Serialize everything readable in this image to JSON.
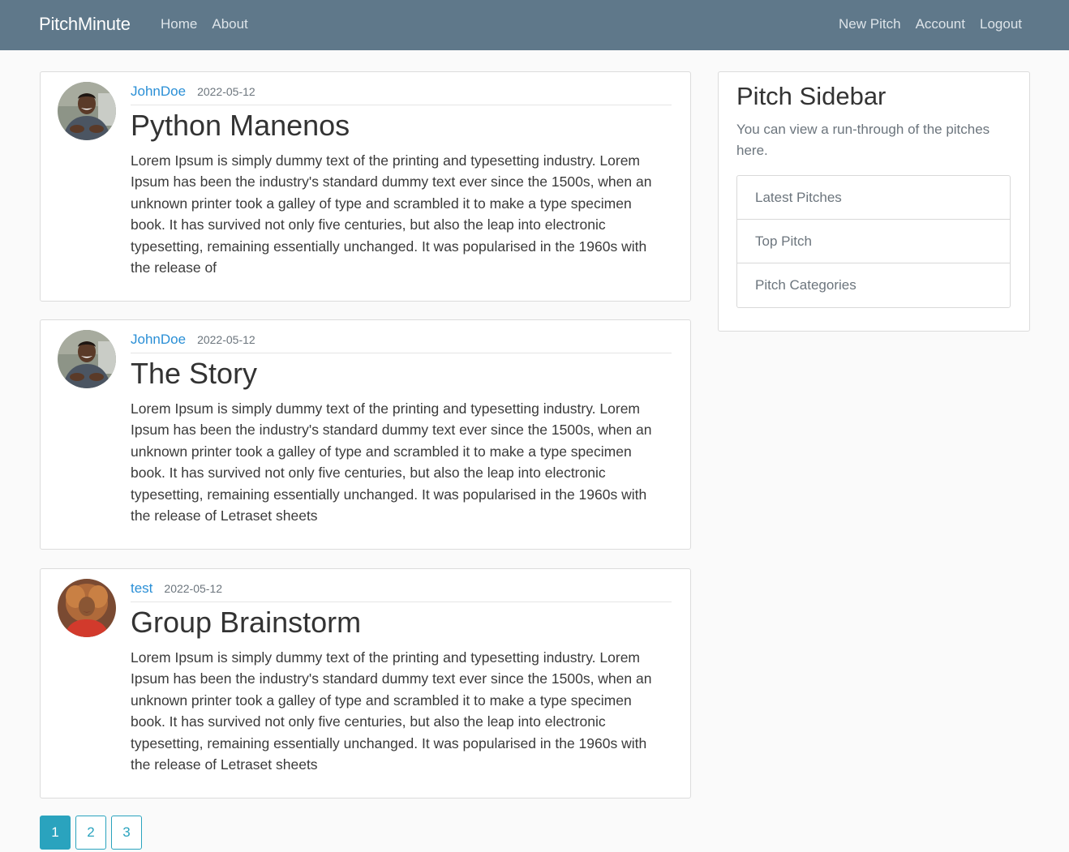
{
  "nav": {
    "brand": "PitchMinute",
    "left_links": [
      "Home",
      "About"
    ],
    "right_links": [
      "New Pitch",
      "Account",
      "Logout"
    ]
  },
  "posts": [
    {
      "author": "JohnDoe",
      "date": "2022-05-12",
      "title": "Python Manenos",
      "body": "Lorem Ipsum is simply dummy text of the printing and typesetting industry. Lorem Ipsum has been the industry's standard dummy text ever since the 1500s, when an unknown printer took a galley of type and scrambled it to make a type specimen book. It has survived not only five centuries, but also the leap into electronic typesetting, remaining essentially unchanged. It was popularised in the 1960s with the release of"
    },
    {
      "author": "JohnDoe",
      "date": "2022-05-12",
      "title": "The Story",
      "body": "Lorem Ipsum is simply dummy text of the printing and typesetting industry. Lorem Ipsum has been the industry's standard dummy text ever since the 1500s, when an unknown printer took a galley of type and scrambled it to make a type specimen book. It has survived not only five centuries, but also the leap into electronic typesetting, remaining essentially unchanged. It was popularised in the 1960s with the release of Letraset sheets"
    },
    {
      "author": "test",
      "date": "2022-05-12",
      "title": "Group Brainstorm",
      "body": "Lorem Ipsum is simply dummy text of the printing and typesetting industry. Lorem Ipsum has been the industry's standard dummy text ever since the 1500s, when an unknown printer took a galley of type and scrambled it to make a type specimen book. It has survived not only five centuries, but also the leap into electronic typesetting, remaining essentially unchanged. It was popularised in the 1960s with the release of Letraset sheets"
    }
  ],
  "sidebar": {
    "title": "Pitch Sidebar",
    "text": "You can view a run-through of the pitches here.",
    "items": [
      "Latest Pitches",
      "Top Pitch",
      "Pitch Categories"
    ]
  },
  "pagination": {
    "pages": [
      "1",
      "2",
      "3"
    ],
    "active": "1"
  },
  "colors": {
    "navbar": "#5f788a",
    "link": "#2a8fd6",
    "accent": "#2aa3be"
  }
}
